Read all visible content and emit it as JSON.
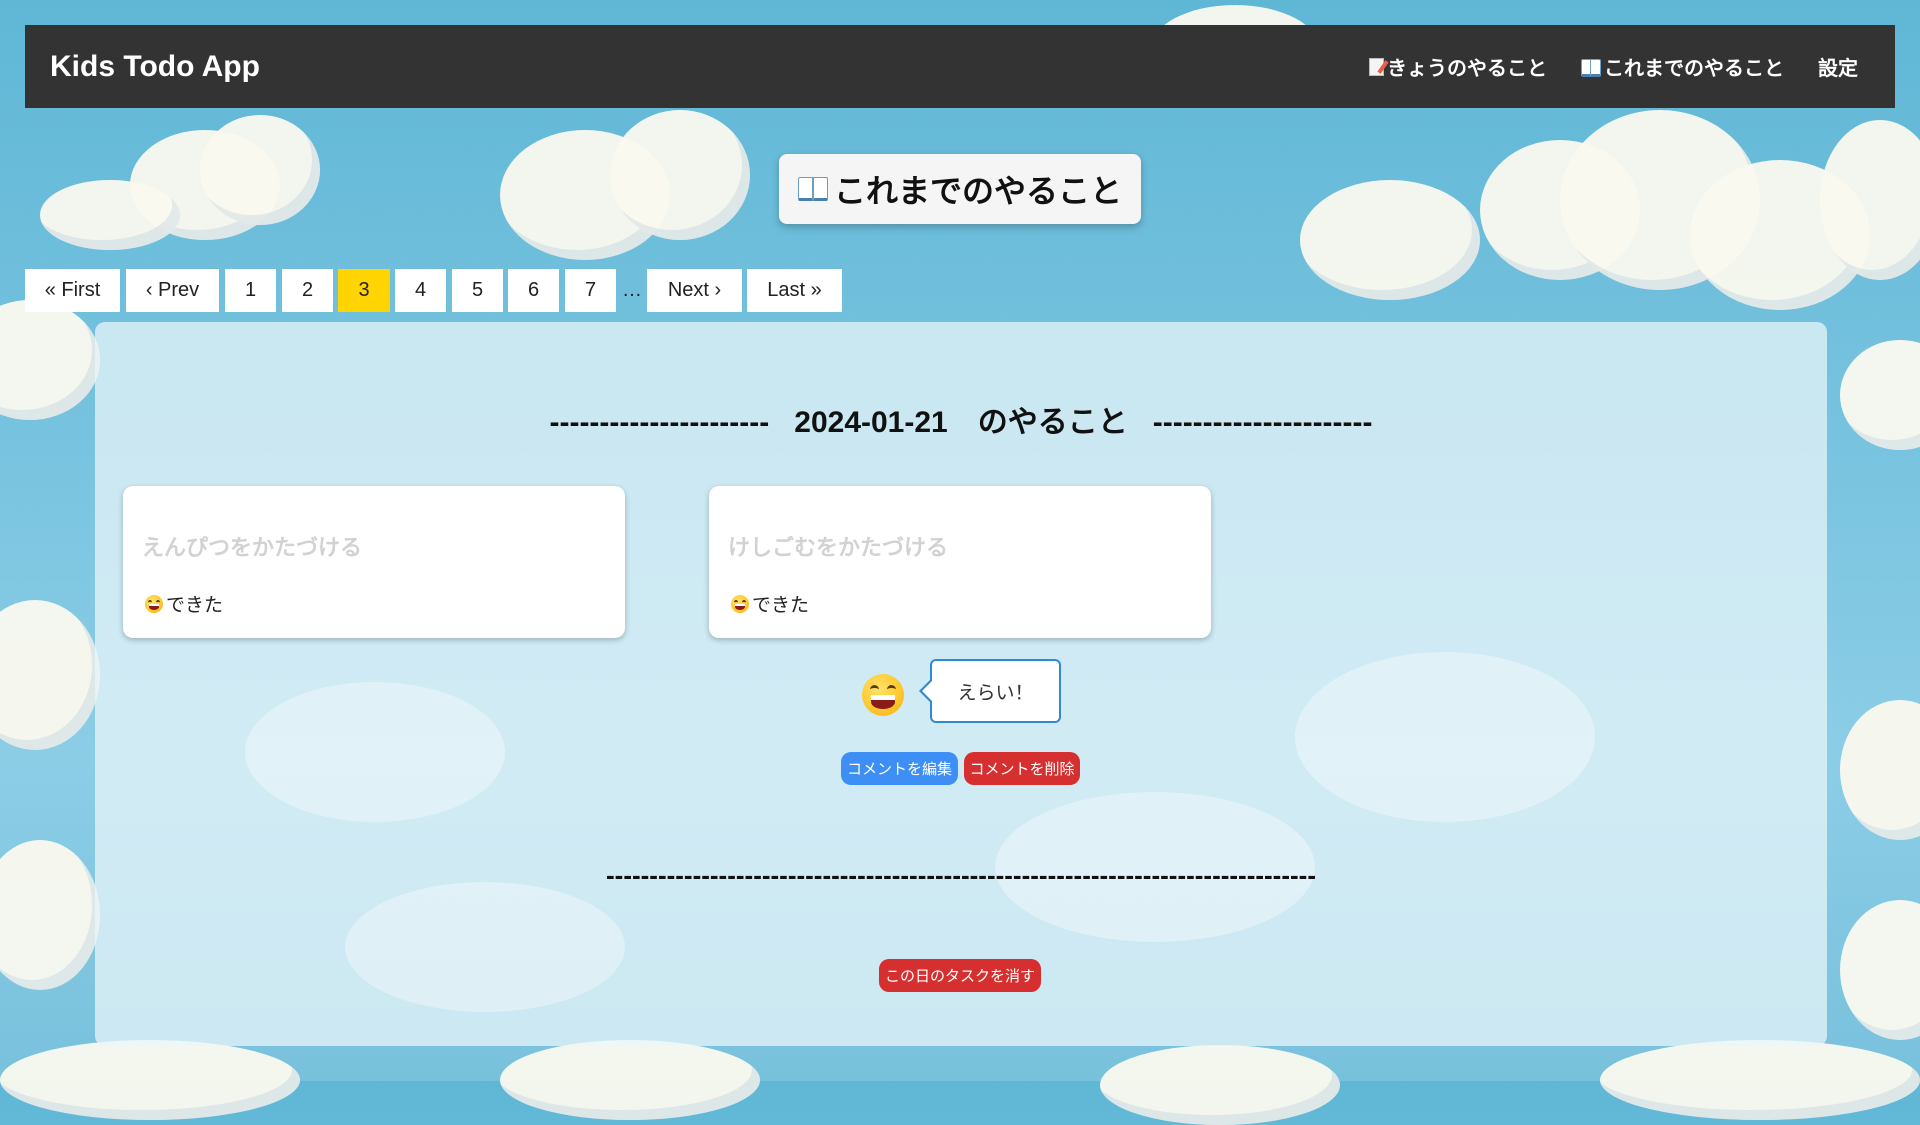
{
  "navbar": {
    "brand": "Kids Todo App",
    "links": [
      {
        "label": "きょうのやること",
        "icon": "memo-icon"
      },
      {
        "label": "これまでのやること",
        "icon": "open-book-icon"
      },
      {
        "label": "設定"
      }
    ]
  },
  "page_title": {
    "label": "これまでのやること",
    "icon": "open-book-icon"
  },
  "pagination": {
    "first": "« First",
    "prev": "‹ Prev",
    "pages": [
      "1",
      "2",
      "3",
      "4",
      "5",
      "6",
      "7"
    ],
    "current": "3",
    "ellipsis": "…",
    "next": "Next ›",
    "last": "Last »",
    "active_color": "#ffd400"
  },
  "day": {
    "heading": "----------------------   2024-01-21　のやること   ----------------------",
    "tasks": [
      {
        "title": "えんぴつをかたづける",
        "status": "できた",
        "status_icon": "grinning-face-icon"
      },
      {
        "title": "けしごむをかたづける",
        "status": "できた",
        "status_icon": "grinning-face-icon"
      }
    ],
    "comment": {
      "text": "えらい！",
      "icon": "grinning-face-icon"
    },
    "edit_comment_label": "コメントを編集",
    "delete_comment_label": "コメントを削除",
    "divider": "----------------------------------------------------------------------------------",
    "delete_day_label": "この日のタスクを消す"
  },
  "colors": {
    "navbar": "#333333",
    "primary_button": "#3d8ff5",
    "danger_button": "#d62f2f",
    "bubble_border": "#2f8ad3"
  }
}
